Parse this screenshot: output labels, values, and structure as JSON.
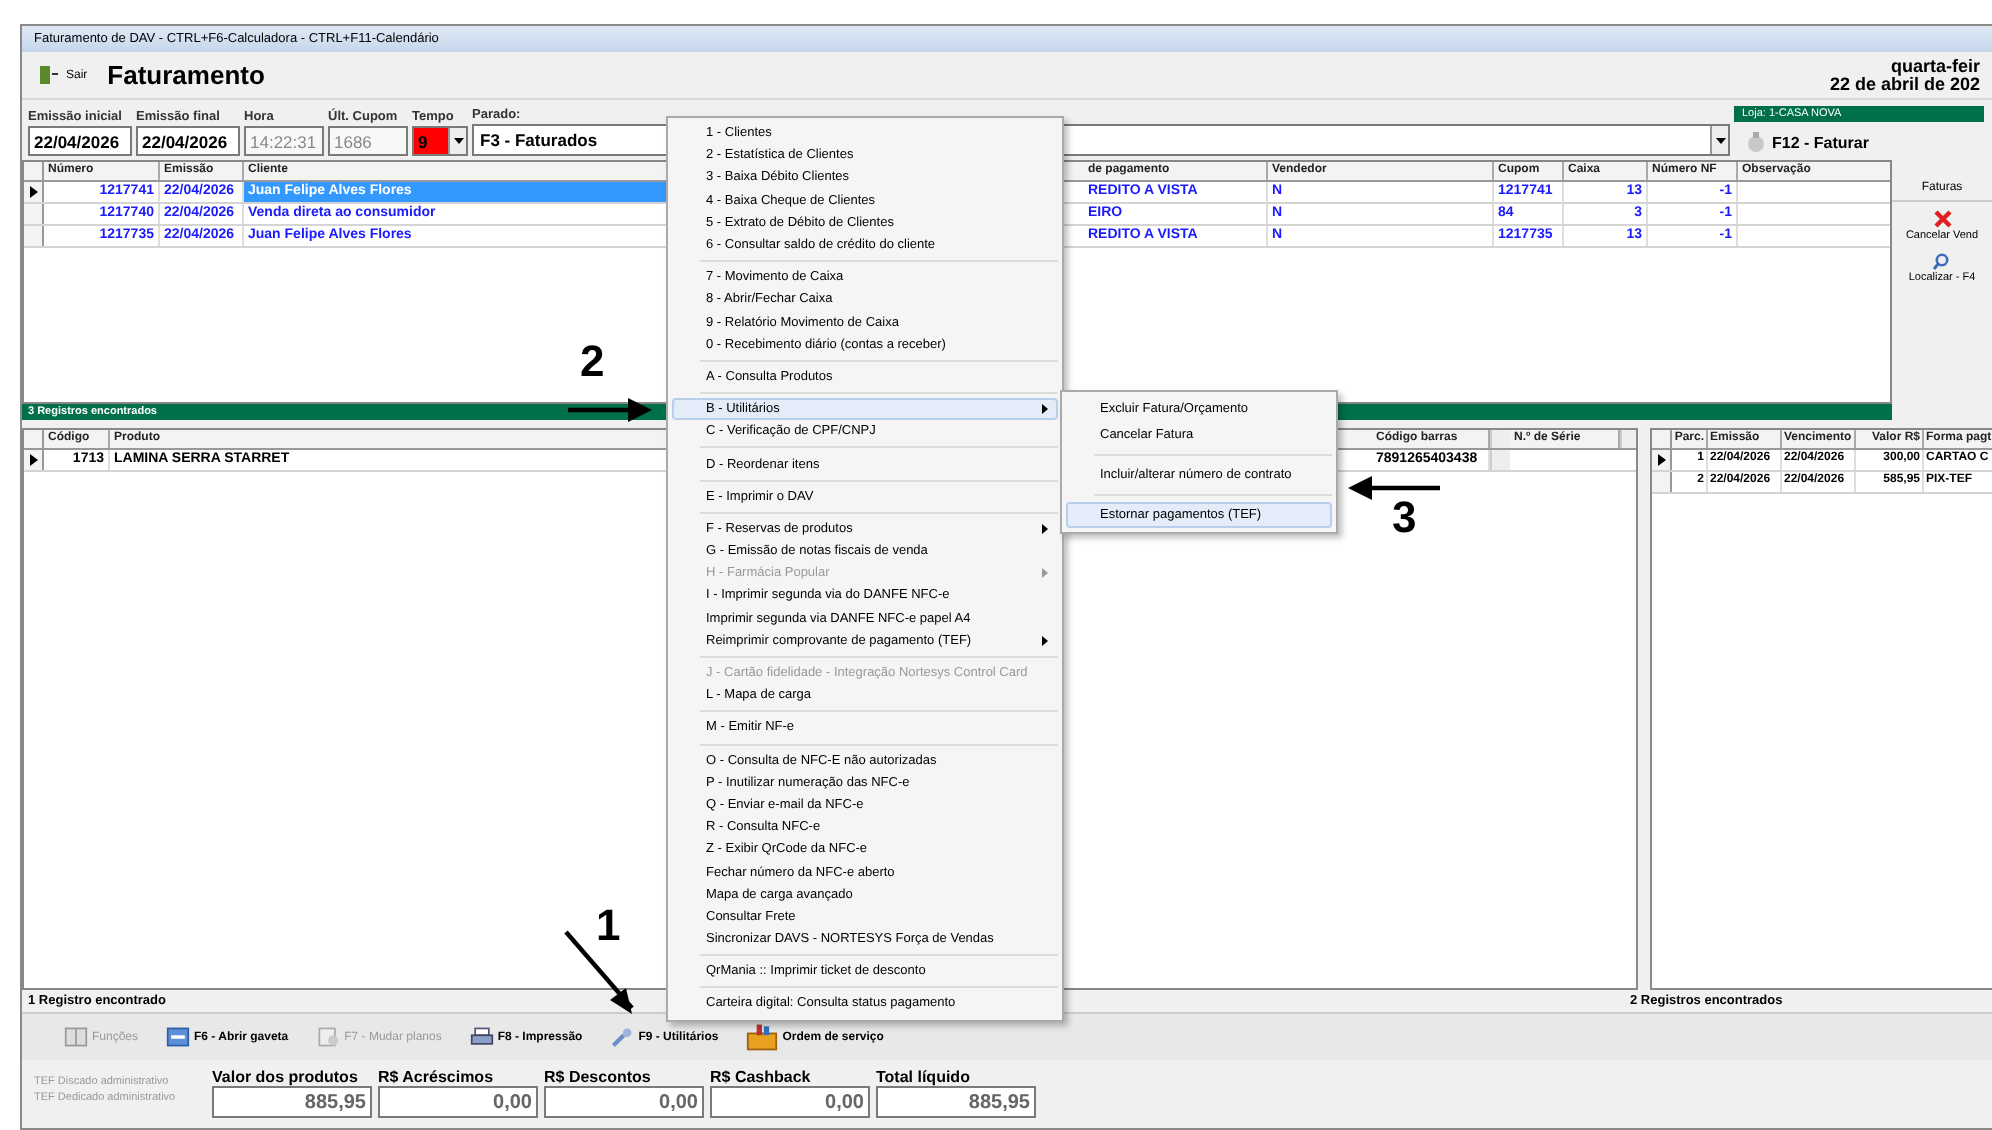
{
  "window": {
    "title": "Faturamento de DAV -  CTRL+F6-Calculadora - CTRL+F11-Calendário"
  },
  "toolbar": {
    "exit_button": "Sair",
    "title": "Faturamento",
    "date_line_1": "quarta-feir",
    "date_line_2": "22 de abril de 202"
  },
  "filters": [
    {
      "kind": "input",
      "label": "Emissão inicial",
      "value": "22/04/2026",
      "disabled": false
    },
    {
      "kind": "input",
      "label": "Emissão final",
      "value": "22/04/2026",
      "disabled": false
    },
    {
      "kind": "input",
      "label": "Hora",
      "value": "14:22:31",
      "disabled": true
    },
    {
      "kind": "input",
      "label": "Últ. Cupom",
      "value": "1686",
      "disabled": true
    },
    {
      "kind": "timer",
      "label": "Tempo",
      "value": "9",
      "disabled": false
    },
    {
      "kind": "dropdown",
      "label": "Parado:",
      "value": "F3 - Faturados",
      "disabled": false
    }
  ],
  "store": "Loja: 1-CASA NOVA",
  "bill_button": "F12 - Faturar",
  "orders": {
    "columns": [
      "Número",
      "Emissão",
      "Cliente",
      "de pagamento",
      "Vendedor",
      "Cupom",
      "Caixa",
      "Número NF",
      "Observação"
    ],
    "rows": [
      {
        "selected": true,
        "cells": [
          "1217741",
          "22/04/2026",
          "Juan Felipe Alves Flores",
          "REDITO A VISTA",
          "N",
          "1217741",
          "13",
          "-1"
        ]
      },
      {
        "selected": false,
        "cells": [
          "1217740",
          "22/04/2026",
          "Venda direta ao consumidor",
          "EIRO",
          "N",
          "84",
          "3",
          "-1"
        ]
      },
      {
        "selected": false,
        "cells": [
          "1217735",
          "22/04/2026",
          "Juan Felipe Alves Flores",
          "REDITO A VISTA",
          "N",
          "1217735",
          "13",
          "-1"
        ]
      }
    ]
  },
  "invoices_panel": {
    "title": "Faturas",
    "buttons": [
      {
        "kind": "cancel",
        "label": "Cancelar Vend"
      },
      {
        "kind": "find",
        "label": "Localizar - F4"
      }
    ]
  },
  "records_bar": "3 Registros encontrados",
  "items": {
    "columns": [
      "Código",
      "Produto",
      "Código barras",
      "N.º de Série"
    ],
    "rows": [
      {
        "selected": true,
        "cells": [
          "1713",
          "LAMINA SERRA STARRET",
          "7891265403438"
        ]
      }
    ]
  },
  "installments": {
    "columns": [
      "Parc.",
      "Emissão",
      "Vencimento",
      "Valor R$",
      "Forma pagt"
    ],
    "rows": [
      {
        "selected": true,
        "cells": [
          "1",
          "22/04/2026",
          "22/04/2026",
          "300,00",
          "CARTAO C"
        ]
      },
      {
        "selected": false,
        "cells": [
          "2",
          "22/04/2026",
          "22/04/2026",
          "585,95",
          "PIX-TEF"
        ]
      }
    ]
  },
  "items_status": "1 Registro encontrado",
  "installments_status": "2 Registros encontrados",
  "actions": [
    {
      "kind": "book",
      "label": "Funções",
      "disabled": true
    },
    {
      "kind": "drawer",
      "label": "F6 - Abrir gaveta",
      "disabled": false
    },
    {
      "kind": "plans",
      "label": "F7 - Mudar planos",
      "disabled": true
    },
    {
      "kind": "printer",
      "label": "F8 - Impressão",
      "disabled": false
    },
    {
      "kind": "wrench",
      "label": "F9 - Utilitários",
      "disabled": false
    },
    {
      "kind": "toolbox",
      "label": "Ordem de serviço",
      "disabled": false
    }
  ],
  "tef_links": [
    {
      "label": "TEF Discado administrativo",
      "disabled": true
    },
    {
      "label": "TEF Dedicado administrativo",
      "disabled": true
    }
  ],
  "totals": [
    {
      "label": "Valor dos produtos",
      "value": "885,95"
    },
    {
      "label": "R$ Acréscimos",
      "value": "0,00"
    },
    {
      "label": "R$ Descontos",
      "value": "0,00"
    },
    {
      "label": "R$ Cashback",
      "value": "0,00"
    },
    {
      "label": "Total líquido",
      "value": "885,95"
    }
  ],
  "menu": {
    "groups": [
      [
        {
          "label": "1 - Clientes",
          "disabled": false,
          "submenu": false,
          "selected": false
        },
        {
          "label": "2 - Estatística de Clientes",
          "disabled": false,
          "submenu": false,
          "selected": false
        },
        {
          "label": "3 - Baixa Débito Clientes",
          "disabled": false,
          "submenu": false,
          "selected": false
        },
        {
          "label": "4 - Baixa Cheque de Clientes",
          "disabled": false,
          "submenu": false,
          "selected": false
        },
        {
          "label": "5 - Extrato de Débito de Clientes",
          "disabled": false,
          "submenu": false,
          "selected": false
        },
        {
          "label": "6 - Consultar saldo de crédito do cliente",
          "disabled": false,
          "submenu": false,
          "selected": false
        }
      ],
      [
        {
          "label": "7 - Movimento de Caixa",
          "disabled": false,
          "submenu": false,
          "selected": false
        },
        {
          "label": "8 - Abrir/Fechar Caixa",
          "disabled": false,
          "submenu": false,
          "selected": false
        },
        {
          "label": "9 - Relatório Movimento de Caixa",
          "disabled": false,
          "submenu": false,
          "selected": false
        },
        {
          "label": "0 - Recebimento diário (contas a receber)",
          "disabled": false,
          "submenu": false,
          "selected": false
        }
      ],
      [
        {
          "label": "A - Consulta Produtos",
          "disabled": false,
          "submenu": false,
          "selected": false
        }
      ],
      [
        {
          "label": "B - Utilitários",
          "disabled": false,
          "submenu": true,
          "selected": true
        },
        {
          "label": "C - Verificação de CPF/CNPJ",
          "disabled": false,
          "submenu": false,
          "selected": false
        }
      ],
      [
        {
          "label": "D - Reordenar itens",
          "disabled": false,
          "submenu": false,
          "selected": false
        }
      ],
      [
        {
          "label": "E - Imprimir o DAV",
          "disabled": false,
          "submenu": false,
          "selected": false
        }
      ],
      [
        {
          "label": "F - Reservas de produtos",
          "disabled": false,
          "submenu": true,
          "selected": false
        },
        {
          "label": "G - Emissão de notas fiscais de venda",
          "disabled": false,
          "submenu": false,
          "selected": false
        },
        {
          "label": "H - Farmácia Popular",
          "disabled": true,
          "submenu": true,
          "selected": false
        },
        {
          "label": "I - Imprimir segunda via do DANFE NFC-e",
          "disabled": false,
          "submenu": false,
          "selected": false
        },
        {
          "label": "Imprimir segunda via DANFE NFC-e papel A4",
          "disabled": false,
          "submenu": false,
          "selected": false
        },
        {
          "label": "Reimprimir comprovante de pagamento (TEF)",
          "disabled": false,
          "submenu": true,
          "selected": false
        }
      ],
      [
        {
          "label": "J - Cartão fidelidade - Integração Nortesys Control Card",
          "disabled": true,
          "submenu": false,
          "selected": false
        },
        {
          "label": "L - Mapa de carga",
          "disabled": false,
          "submenu": false,
          "selected": false
        }
      ],
      [
        {
          "label": "M - Emitir NF-e",
          "disabled": false,
          "submenu": false,
          "selected": false
        }
      ],
      [
        {
          "label": "O - Consulta de NFC-E não autorizadas",
          "disabled": false,
          "submenu": false,
          "selected": false
        },
        {
          "label": "P - Inutilizar numeração das NFC-e",
          "disabled": false,
          "submenu": false,
          "selected": false
        },
        {
          "label": "Q - Enviar e-mail da NFC-e",
          "disabled": false,
          "submenu": false,
          "selected": false
        },
        {
          "label": "R - Consulta NFC-e",
          "disabled": false,
          "submenu": false,
          "selected": false
        },
        {
          "label": "Z - Exibir QrCode da NFC-e",
          "disabled": false,
          "submenu": false,
          "selected": false
        },
        {
          "label": "Fechar número da NFC-e aberto",
          "disabled": false,
          "submenu": false,
          "selected": false
        },
        {
          "label": "Mapa de carga avançado",
          "disabled": false,
          "submenu": false,
          "selected": false
        },
        {
          "label": "Consultar Frete",
          "disabled": false,
          "submenu": false,
          "selected": false
        },
        {
          "label": "Sincronizar DAVS - NORTESYS Força de Vendas",
          "disabled": false,
          "submenu": false,
          "selected": false
        }
      ],
      [
        {
          "label": "QrMania :: Imprimir ticket de desconto",
          "disabled": false,
          "submenu": false,
          "selected": false
        }
      ],
      [
        {
          "label": "Carteira digital: Consulta status pagamento",
          "disabled": false,
          "submenu": false,
          "selected": false
        }
      ]
    ]
  },
  "submenu": {
    "groups": [
      [
        {
          "label": "Excluir Fatura/Orçamento",
          "selected": false
        },
        {
          "label": "Cancelar Fatura",
          "selected": false
        }
      ],
      [
        {
          "label": "Incluir/alterar número de contrato",
          "selected": false
        }
      ],
      [
        {
          "label": "Estornar pagamentos (TEF)",
          "selected": true
        }
      ]
    ]
  },
  "annotations": [
    {
      "text": "1"
    },
    {
      "text": "2"
    },
    {
      "text": "3"
    }
  ]
}
